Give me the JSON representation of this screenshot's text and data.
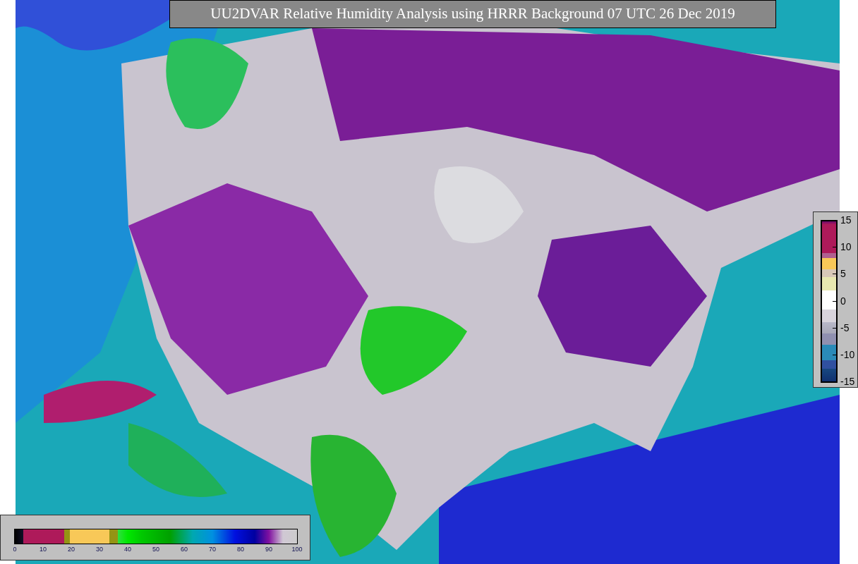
{
  "title": "UU2DVAR Relative Humidity Analysis using HRRR Background 07 UTC 26 Dec 2019",
  "side_colorbar": {
    "ticks": [
      "15",
      "10",
      "5",
      "0",
      "-5",
      "-10",
      "-15"
    ]
  },
  "bottom_colorbar": {
    "ticks": [
      "0",
      "10",
      "20",
      "30",
      "40",
      "50",
      "60",
      "70",
      "80",
      "90",
      "100"
    ]
  }
}
